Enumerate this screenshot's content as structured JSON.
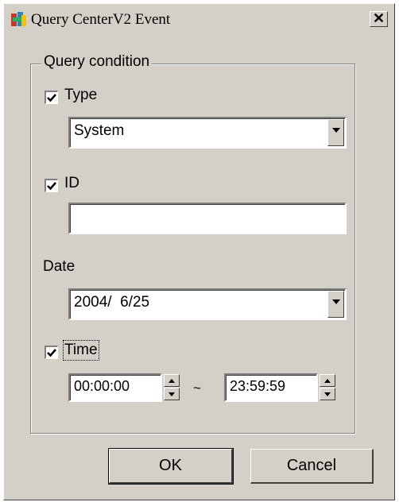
{
  "window": {
    "title": "Query CenterV2 Event",
    "close_glyph": "✕"
  },
  "group": {
    "label": "Query condition"
  },
  "type_filter": {
    "label": "Type",
    "checked": true,
    "selected": "System"
  },
  "id_filter": {
    "label": "ID",
    "checked": true,
    "value": ""
  },
  "date_filter": {
    "label": "Date",
    "selected": "2004/  6/25"
  },
  "time_filter": {
    "label": "Time",
    "checked": true,
    "start": "00:00:00",
    "separator": "~",
    "end": "23:59:59"
  },
  "buttons": {
    "ok": "OK",
    "cancel": "Cancel"
  }
}
